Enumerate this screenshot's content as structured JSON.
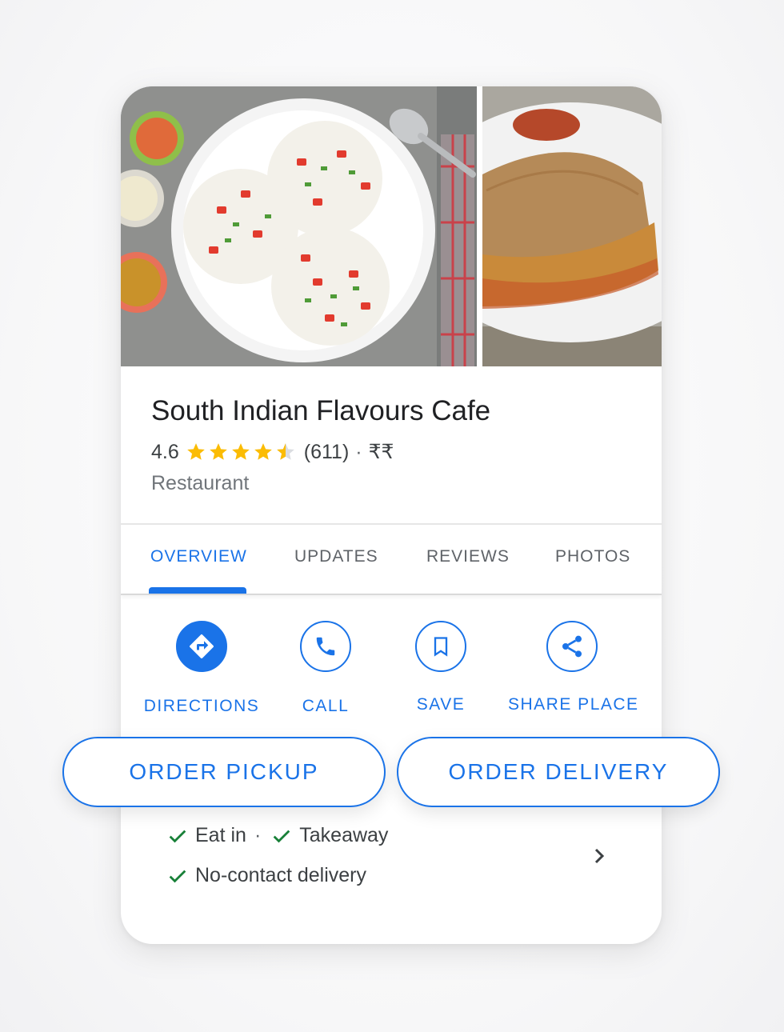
{
  "place": {
    "name": "South Indian Flavours Cafe",
    "rating": "4.6",
    "stars": 4.5,
    "review_count": "(611)",
    "price_separator": "·",
    "price_level": "₹₹",
    "category": "Restaurant"
  },
  "photos": [
    {
      "icon": "uttapam-plate-photo"
    },
    {
      "icon": "dosa-plate-photo"
    }
  ],
  "tabs": [
    {
      "label": "OVERVIEW",
      "active": true
    },
    {
      "label": "UPDATES",
      "active": false
    },
    {
      "label": "REVIEWS",
      "active": false
    },
    {
      "label": "PHOTOS",
      "active": false
    }
  ],
  "actions": [
    {
      "label": "DIRECTIONS",
      "icon": "directions-icon"
    },
    {
      "label": "CALL",
      "icon": "phone-icon"
    },
    {
      "label": "SAVE",
      "icon": "bookmark-icon"
    },
    {
      "label": "SHARE PLACE",
      "icon": "share-icon"
    }
  ],
  "order": {
    "pickup_label": "ORDER PICKUP",
    "delivery_label": "ORDER DELIVERY"
  },
  "services": {
    "eat_in": "Eat in",
    "separator": "·",
    "takeaway": "Takeaway",
    "no_contact": "No-contact delivery"
  },
  "colors": {
    "accent": "#1a73e8",
    "star": "#fbbc04",
    "check": "#188038",
    "title_text": "#202124",
    "secondary_text": "#70757a"
  }
}
